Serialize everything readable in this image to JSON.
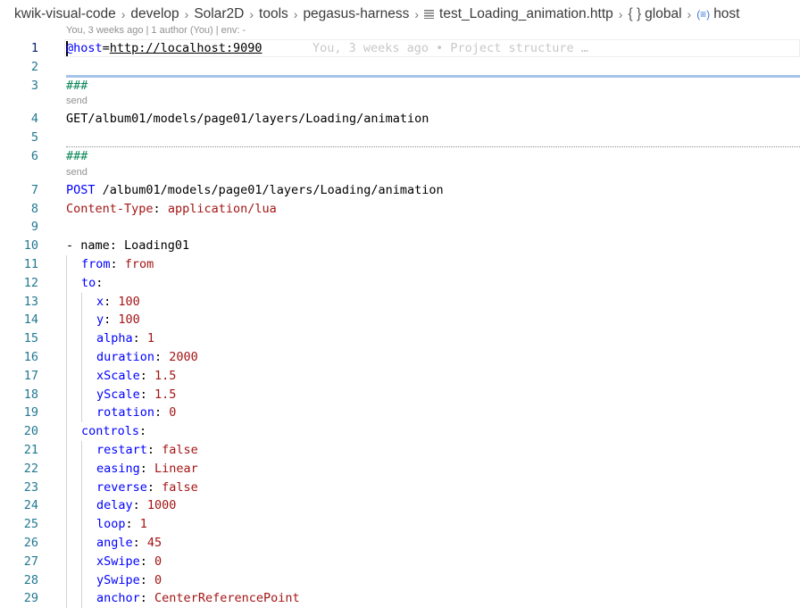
{
  "breadcrumb": {
    "items": [
      "kwik-visual-code",
      "develop",
      "Solar2D",
      "tools",
      "pegasus-harness"
    ],
    "file": "test_Loading_animation.http",
    "scope": "global",
    "symbol_icon": "(≡)",
    "symbol": "host"
  },
  "lens": {
    "blame_header": "You, 3 weeks ago | 1 author (You) | env: -",
    "send_label": "send",
    "inline_blame": "You, 3 weeks ago • Project structure …"
  },
  "lines": {
    "l1": {
      "num": "1",
      "a": "@host",
      "eq": "=",
      "url": "http://localhost:9090"
    },
    "l2": {
      "num": "2"
    },
    "l3": {
      "num": "3",
      "text": "###"
    },
    "l4": {
      "num": "4",
      "text": "GET/album01/models/page01/layers/Loading/animation"
    },
    "l5": {
      "num": "5"
    },
    "l6": {
      "num": "6",
      "text": "###"
    },
    "l7": {
      "num": "7",
      "method": "POST",
      "path": " /album01/models/page01/layers/Loading/animation"
    },
    "l8": {
      "num": "8",
      "key": "Content-Type",
      "colon": ": ",
      "val": "application/lua"
    },
    "l9": {
      "num": "9"
    },
    "l10": {
      "num": "10",
      "text": "- name: Loading01"
    },
    "l11": {
      "num": "11",
      "key": "from",
      "colon": ": ",
      "val": "from"
    },
    "l12": {
      "num": "12",
      "key": "to",
      "colon": ":"
    },
    "l13": {
      "num": "13",
      "key": "x",
      "colon": ": ",
      "val": "100"
    },
    "l14": {
      "num": "14",
      "key": "y",
      "colon": ": ",
      "val": "100"
    },
    "l15": {
      "num": "15",
      "key": "alpha",
      "colon": ": ",
      "val": "1"
    },
    "l16": {
      "num": "16",
      "key": "duration",
      "colon": ": ",
      "val": "2000"
    },
    "l17": {
      "num": "17",
      "key": "xScale",
      "colon": ": ",
      "val": "1.5"
    },
    "l18": {
      "num": "18",
      "key": "yScale",
      "colon": ": ",
      "val": "1.5"
    },
    "l19": {
      "num": "19",
      "key": "rotation",
      "colon": ": ",
      "val": "0"
    },
    "l20": {
      "num": "20",
      "key": "controls",
      "colon": ":"
    },
    "l21": {
      "num": "21",
      "key": "restart",
      "colon": ": ",
      "val": "false"
    },
    "l22": {
      "num": "22",
      "key": "easing",
      "colon": ": ",
      "val": "Linear"
    },
    "l23": {
      "num": "23",
      "key": "reverse",
      "colon": ": ",
      "val": "false"
    },
    "l24": {
      "num": "24",
      "key": "delay",
      "colon": ": ",
      "val": "1000"
    },
    "l25": {
      "num": "25",
      "key": "loop",
      "colon": ": ",
      "val": "1"
    },
    "l26": {
      "num": "26",
      "key": "angle",
      "colon": ": ",
      "val": "45"
    },
    "l27": {
      "num": "27",
      "key": "xSwipe",
      "colon": ": ",
      "val": "0"
    },
    "l28": {
      "num": "28",
      "key": "ySwipe",
      "colon": ": ",
      "val": "0"
    },
    "l29": {
      "num": "29",
      "key": "anchor",
      "colon": ": ",
      "val": "CenterReferencePoint"
    }
  },
  "colors": {
    "keyword": "#0000ff",
    "value": "#a31515",
    "comment": "#098658",
    "line_number": "#237893",
    "separator": "#a6c4ea"
  }
}
